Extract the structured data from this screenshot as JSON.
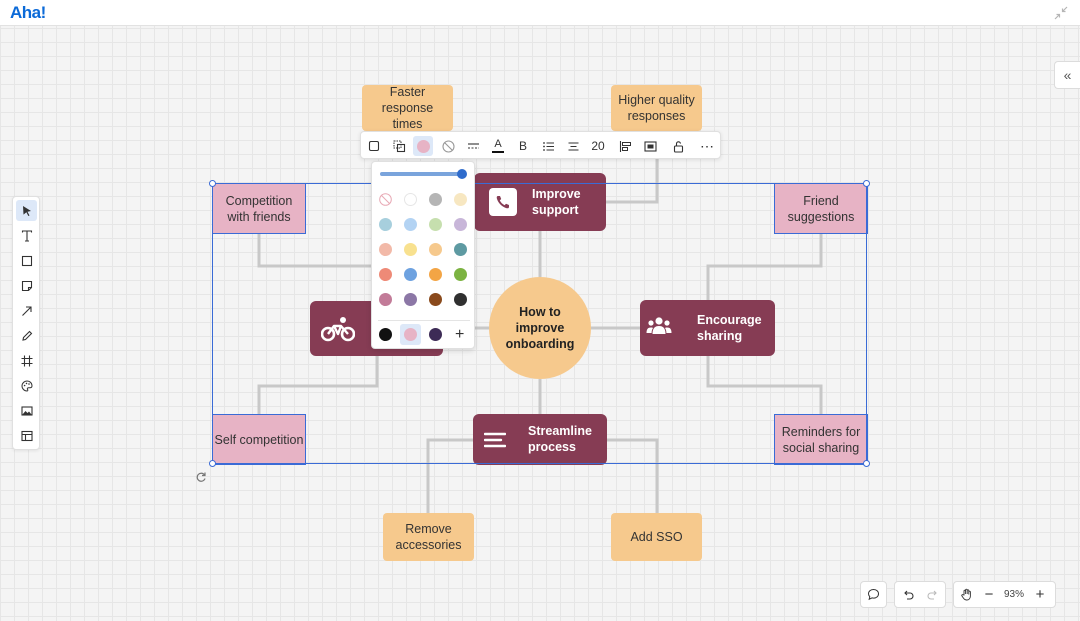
{
  "app": {
    "logo": "Aha!"
  },
  "canvas": {
    "nodes": {
      "faster_response": "Faster response times",
      "higher_quality": "Higher quality responses",
      "competition_friends": "Competition with friends",
      "friend_suggestions": "Friend suggestions",
      "improve_support": "Improve support",
      "encourage_sharing": "Encourage sharing",
      "center": "How to improve onboarding",
      "self_competition": "Self competition",
      "reminders_sharing": "Reminders for social sharing",
      "streamline_process": "Streamline process",
      "remove_accessories": "Remove accessories",
      "add_sso": "Add SSO"
    },
    "icons": {
      "improve_support": "phone-icon",
      "encourage_sharing": "users-icon",
      "streamline_process": "menu-lines-icon",
      "bike_node": "bicycle-icon"
    },
    "colors": {
      "orange": "#f6c98d",
      "pink": "#e7b3c5",
      "maroon": "#863c54",
      "selection": "#3a6bd6",
      "connector": "#c8c8c8"
    }
  },
  "format_toolbar": {
    "font_size": "20",
    "text_color_letter": "A",
    "bold_letter": "B",
    "more": "⋯"
  },
  "palette": {
    "opacity_percent": 100,
    "rows": [
      [
        "none",
        "#ffffff",
        "#b5b5b5",
        "#f7e7c1"
      ],
      [
        "#a7cfdd",
        "#b3d3f3",
        "#c6dfae",
        "#c8b6d9"
      ],
      [
        "#f2b9a8",
        "#f8e18f",
        "#f6c98d",
        "#5e9aa2"
      ],
      [
        "#ee8a77",
        "#6ea2e0",
        "#f3a545",
        "#7cb342"
      ],
      [
        "#c27b98",
        "#8c77a6",
        "#8a4a1c",
        "#303030"
      ]
    ],
    "recent": [
      "#111111",
      "#e7b3c5",
      "#3d2b56"
    ],
    "recent_selected": 1,
    "add_label": "+"
  },
  "zoom": {
    "level": "93%"
  }
}
